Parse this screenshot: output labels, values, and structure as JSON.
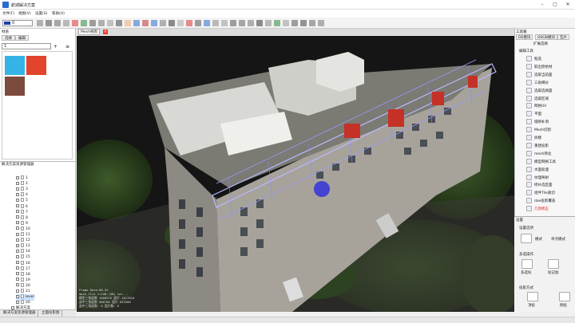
{
  "app": {
    "title": "航城解决方案"
  },
  "menu": [
    "文件(F)",
    "视图(V)",
    "设置(S)",
    "帮助(H)"
  ],
  "layer_combo": {
    "value": "0"
  },
  "left_panel": {
    "title": "材质",
    "tabs": [
      "选择",
      "编辑"
    ],
    "material_value": "1",
    "add_label": "+",
    "menu_label": "≡",
    "materials": [
      {
        "color": "#34b4e6"
      },
      {
        "color": "#e2442c"
      },
      {
        "color": "#7d4a3e"
      }
    ]
  },
  "tree": {
    "title": "解决方案资源管理器",
    "items": [
      "1",
      "2",
      "3",
      "4",
      "5",
      "6",
      "7",
      "8",
      "9",
      "10",
      "11",
      "12",
      "13",
      "14",
      "15",
      "16",
      "17",
      "18",
      "19",
      "20",
      "21",
      "level",
      "20"
    ],
    "selected_label": "level",
    "last_group": "解决方案"
  },
  "bottom_tabs": [
    "解决方案资源管理器",
    "立面投影图"
  ],
  "doc_tab": {
    "label": "Mesh视图"
  },
  "view_tabs": [
    "重置视角",
    "透视图",
    "顶视图",
    "底视图",
    "模型",
    "灯光",
    "背面剔除",
    "Tile网格",
    "坐标",
    "删除"
  ],
  "viewport_stats": [
    "Frame Rate:60.52",
    "mesh_file >>1GB.(GB) ver...",
    "模型三角面数 1608976  面片 1617818",
    "选中三角面数 686786  面片 653368",
    "选中三角面数: 0  面片数: 0"
  ],
  "right_panel": {
    "title": "工具箱",
    "tabs": [
      "OE模块",
      "OSGB模块",
      "瓦片"
    ],
    "group_label": "扩展选择",
    "section_label": "编辑工具",
    "tools": [
      "框选",
      "取出原始材",
      "选取当前面",
      "三角细分",
      "选取选择面",
      "选取区域",
      "网格UV",
      "平面",
      "缝隙补洞",
      "Mesh切割",
      "拆模",
      "重建投影",
      "mesh简化",
      "模型网格工具",
      "水面处理",
      "纹理映射",
      "修补选区面",
      "组件Tile裁切",
      "dae投影覆盖",
      "几何修正"
    ],
    "highlighted_tool": "几何修正"
  },
  "settings": {
    "title": "设置",
    "subtitle": "设置选项",
    "mode_label": "模式",
    "mode_value": "单点模式",
    "select_label": "多选操作",
    "btn_a": "多选标",
    "btn_b": "标记加",
    "project_label": "投影方式",
    "btn_c": "顶投",
    "btn_d": "侧投"
  }
}
